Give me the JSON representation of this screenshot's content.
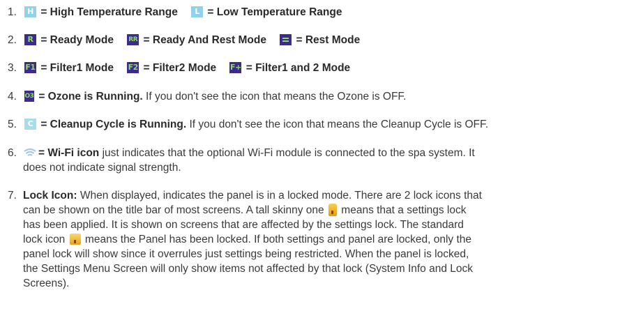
{
  "items": [
    {
      "num": "1.",
      "parts": {
        "h_icon": "H",
        "h_label": "= High Temperature Range",
        "l_icon": "L",
        "l_label": "= Low Temperature Range"
      }
    },
    {
      "num": "2.",
      "parts": {
        "r_icon": "R",
        "r_label": "= Ready Mode",
        "rr_icon": "RR",
        "rr_label": "= Ready And Rest Mode",
        "rest_label": "= Rest Mode"
      }
    },
    {
      "num": "3.",
      "parts": {
        "f1_icon": "F1",
        "f1_label": "= Filter1 Mode",
        "f2_icon": "F2",
        "f2_label": "= Filter2 Mode",
        "fp_icon": "F+",
        "fp_label": "= Filter1 and 2 Mode"
      }
    },
    {
      "num": "4.",
      "parts": {
        "o3_icon": "O3",
        "bold": "= Ozone is Running.",
        "text": " If you don't see the icon that means the Ozone is OFF."
      }
    },
    {
      "num": "5.",
      "parts": {
        "c_icon": "C",
        "bold": "= Cleanup Cycle is Running.",
        "text": " If you don't see the icon that means the Cleanup Cycle is OFF."
      }
    },
    {
      "num": "6.",
      "parts": {
        "bold": "= Wi-Fi icon",
        "line1": " just indicates that the optional Wi-Fi module is connected to the spa system. It",
        "line2": "does not indicate signal strength."
      }
    },
    {
      "num": "7.",
      "parts": {
        "bold": "Lock Icon:",
        "l1": " When displayed, indicates the panel is in a locked mode. There are 2 lock icons that",
        "l2": "can be shown on the title bar of most screens. A tall skinny one",
        "l2b": " means that a settings lock",
        "l3": "has been applied. It is shown on screens that are affected by the settings lock. The standard",
        "l4a": "lock icon",
        "l4b": " means the Panel has been locked. If both settings and panel are locked, only the",
        "l5": "panel lock will show since it overrules just settings being restricted. When the panel is locked,",
        "l6": "the Settings Menu Screen will only show items not affected by that lock (System Info and Lock",
        "l7": "Screens)."
      }
    }
  ],
  "colors": {
    "icon_cyan": "#8fd2ea",
    "icon_purple": "#3d2a8c",
    "icon_green_glyph": "#8be05a",
    "lock_gold": "#e8a21c"
  },
  "icons": {
    "wifi": "wifi-icon",
    "lock_tall": "settings-lock-icon",
    "lock_standard": "panel-lock-icon",
    "rest": "rest-mode-icon"
  }
}
